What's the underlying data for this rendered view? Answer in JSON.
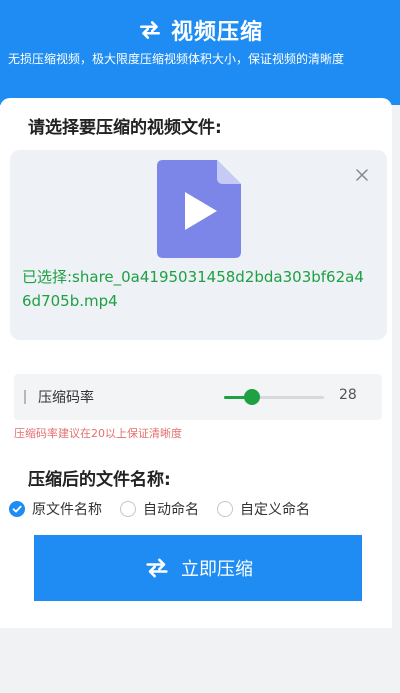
{
  "header": {
    "title": "视频压缩",
    "subtitle": "无损压缩视频，极大限度压缩视频体积大小，保证视频的清晰度",
    "icon": "refresh-icon"
  },
  "file_section": {
    "label": "请选择要压缩的视频文件:",
    "selected_file": "已选择:share_0a4195031458d2bda303bf62a46d705b.mp4",
    "file_icon": "video-file-icon",
    "close_icon": "close-icon"
  },
  "compression_rate": {
    "label": "压缩码率",
    "value": "28",
    "slider_fraction": 0.28,
    "hint": "压缩码率建议在20以上保证清晰度"
  },
  "naming": {
    "label": "压缩后的文件名称:",
    "options": [
      {
        "label": "原文件名称",
        "checked": true
      },
      {
        "label": "自动命名",
        "checked": false
      },
      {
        "label": "自定义命名",
        "checked": false
      }
    ]
  },
  "action": {
    "button_label": "立即压缩"
  },
  "colors": {
    "primary": "#1e8cf2",
    "success": "#1ea043",
    "hint": "#e36f6f",
    "file_icon": "#7b86e8"
  }
}
